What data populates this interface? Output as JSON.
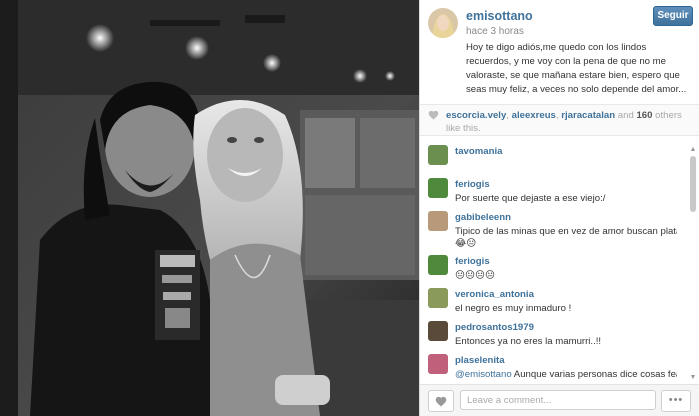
{
  "post": {
    "username": "emisottano",
    "time_ago": "hace 3 horas",
    "follow_label": "Seguir",
    "caption": "Hoy te digo adiós,me quedo con los lindos recuerdos, y me voy con la pena de que no me valoraste, se que mañana estare bien, espero que seas muy feliz, a veces no solo depende del amor..."
  },
  "likes": {
    "users": [
      "escorcia.vely",
      "aleexreus",
      "rjaracatalan"
    ],
    "sep1": ", ",
    "sep2": ", ",
    "and_text": " and ",
    "count": "160",
    "rest": " others like this."
  },
  "comments": [
    {
      "user": "tavomania",
      "text": "",
      "avatar_color": "#6b8f4e"
    },
    {
      "user": "feriogis",
      "text": "Por suerte que dejaste a ese viejo:/",
      "avatar_color": "#4f8a3c"
    },
    {
      "user": "gabibeleenn",
      "text": "Tipico de las minas que en vez de amor buscan plata",
      "text2": "😂😐",
      "avatar_color": "#b89a7a"
    },
    {
      "user": "feriogis",
      "text": "😐😐😐😐",
      "avatar_color": "#4f8a3c"
    },
    {
      "user": "veronica_antonia",
      "text": "el negro es muy inmaduro !",
      "avatar_color": "#8a9a5a"
    },
    {
      "user": "pedrosantos1979",
      "text": "Entonces ya no eres la mamurri..!!",
      "avatar_color": "#5a4a3a"
    },
    {
      "user": "plaselenita",
      "mention": "@emisottano",
      "text": " Aunque varias personas dice cosas feas",
      "avatar_color": "#c0607a"
    }
  ],
  "footer": {
    "comment_placeholder": "Leave a comment...",
    "more_label": "•••"
  },
  "colors": {
    "link": "#3f729b",
    "follow_button": "#3f729b"
  }
}
